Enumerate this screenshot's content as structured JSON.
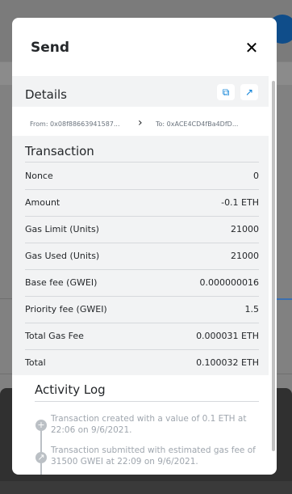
{
  "modal": {
    "title": "Send",
    "close_icon": "close-icon"
  },
  "details": {
    "title": "Details",
    "copy_icon": "copy-icon",
    "view_icon": "external-link-icon",
    "from": "From: 0x08f88663941587...",
    "to": "To: 0xACE4CD4fBa4DfD..."
  },
  "transaction": {
    "title": "Transaction",
    "rows": [
      {
        "label": "Nonce",
        "value": "0"
      },
      {
        "label": "Amount",
        "value": "-0.1 ETH"
      },
      {
        "label": "Gas Limit (Units)",
        "value": "21000"
      },
      {
        "label": "Gas Used (Units)",
        "value": "21000"
      },
      {
        "label": "Base fee (GWEI)",
        "value": "0.000000016"
      },
      {
        "label": "Priority fee (GWEI)",
        "value": "1.5"
      },
      {
        "label": "Total Gas Fee",
        "value": "0.000031 ETH"
      },
      {
        "label": "Total",
        "value": "0.100032 ETH"
      }
    ]
  },
  "activity": {
    "title": "Activity Log",
    "entries": [
      {
        "icon": "plus-icon",
        "text": "Transaction created with a value of 0.1 ETH at 22:06 on 9/6/2021."
      },
      {
        "icon": "arrow-up-right-icon",
        "text": "Transaction submitted with estimated gas fee of 31500 GWEI at 22:09 on 9/6/2021."
      }
    ]
  },
  "colors": {
    "accent": "#037dd6",
    "panel": "#f2f3f4",
    "text": "#24272a",
    "muted": "#9fa6ae"
  }
}
